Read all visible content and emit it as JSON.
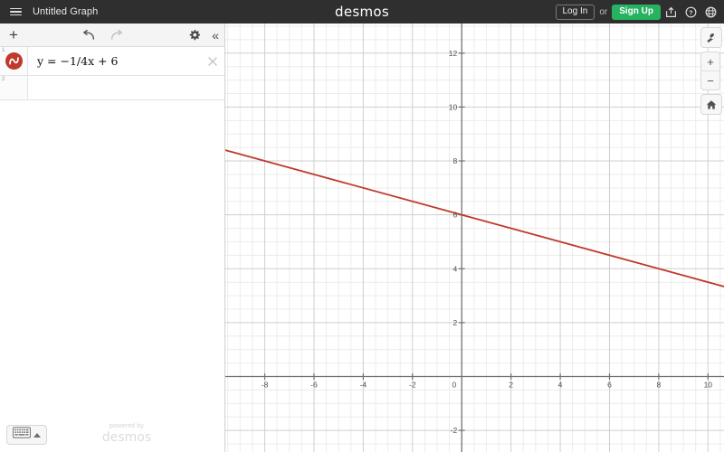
{
  "header": {
    "menu_icon": "hamburger-menu-icon",
    "graph_title": "Untitled Graph",
    "brand": "desmos",
    "login_label": "Log In",
    "or_label": "or",
    "signup_label": "Sign Up",
    "share_icon": "share-icon",
    "help_icon": "help-question-icon",
    "language_icon": "globe-language-icon"
  },
  "panel": {
    "toolbar": {
      "add_label": "+",
      "undo_icon": "undo-arrow-icon",
      "redo_icon": "redo-arrow-icon",
      "settings_icon": "gear-icon",
      "collapse_label": "«"
    },
    "expressions": [
      {
        "index": "1",
        "math": "y = −1/4x + 6",
        "color": "#c0392b",
        "icon": "curve-dot-icon",
        "delete_icon": "close-x-icon"
      },
      {
        "index": "2",
        "math": "",
        "icon": "",
        "delete_icon": ""
      }
    ],
    "keyboard_button": {
      "icon": "keyboard-icon",
      "caret": "caret-up-icon"
    },
    "watermark": {
      "line1": "powered by",
      "line2": "desmos"
    }
  },
  "zoom_tools": {
    "wrench_icon": "wrench-settings-icon",
    "zoom_in_label": "+",
    "zoom_out_label": "−",
    "home_icon": "home-icon"
  },
  "chart_data": {
    "type": "line",
    "title": "Untitled Graph",
    "expression": "y = -1/4x + 6",
    "slope": -0.25,
    "y_intercept": 6,
    "line_color": "#c0392b",
    "xlabel": "",
    "ylabel": "",
    "xlim": [
      -9.6,
      10.65
    ],
    "ylim": [
      -2.8,
      13.1
    ],
    "x_ticks": [
      -8,
      -6,
      -4,
      -2,
      0,
      2,
      4,
      6,
      8,
      10
    ],
    "x_tick_labels": [
      "-8",
      "-6",
      "-4",
      "-2",
      "0",
      "2",
      "4",
      "6",
      "8",
      "10"
    ],
    "y_ticks": [
      -2,
      2,
      4,
      6,
      8,
      10,
      12
    ],
    "y_tick_labels": [
      "-2",
      "2",
      "4",
      "6",
      "8",
      "10",
      "12"
    ],
    "major_grid_step": 2,
    "minor_grid_step": 0.5,
    "grid": true,
    "legend": false,
    "points": [
      {
        "x": -9.6,
        "y": 8.4
      },
      {
        "x": 10.65,
        "y": 3.34
      }
    ]
  }
}
